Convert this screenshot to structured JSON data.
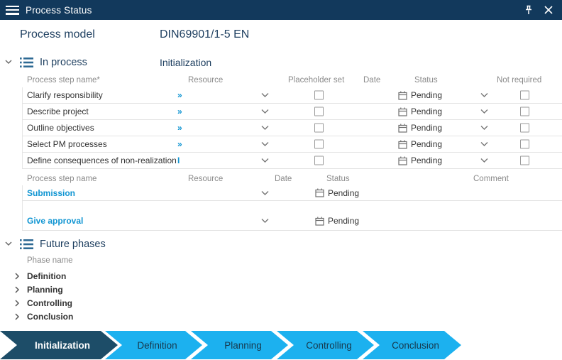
{
  "window": {
    "title": "Process Status"
  },
  "header": {
    "label": "Process model",
    "value": "DIN69901/1-5 EN"
  },
  "in_process": {
    "title": "In process",
    "phase": "Initialization",
    "columns": [
      "Process step name*",
      "Resource",
      "Placeholder set",
      "Date",
      "Status",
      "Not required"
    ],
    "rows": [
      {
        "name": "Clarify responsibility",
        "resource": "»",
        "status": "Pending"
      },
      {
        "name": "Describe project",
        "resource": "»",
        "status": "Pending"
      },
      {
        "name": "Outline objectives",
        "resource": "»",
        "status": "Pending"
      },
      {
        "name": "Select PM processes",
        "resource": "»",
        "status": "Pending"
      },
      {
        "name": "Define consequences of non-realization",
        "resource": "I",
        "status": "Pending"
      }
    ]
  },
  "approval": {
    "columns": [
      "Process step name",
      "Resource",
      "Date",
      "Status",
      "Comment"
    ],
    "rows": [
      {
        "name": "Submission",
        "status": "Pending"
      },
      {
        "name": "Give approval",
        "status": "Pending"
      }
    ]
  },
  "future_phases": {
    "title": "Future phases",
    "column": "Phase name",
    "items": [
      "Definition",
      "Planning",
      "Controlling",
      "Conclusion"
    ]
  },
  "ribbon": {
    "segments": [
      {
        "label": "Initialization",
        "active": true
      },
      {
        "label": "Definition",
        "active": false
      },
      {
        "label": "Planning",
        "active": false
      },
      {
        "label": "Controlling",
        "active": false
      },
      {
        "label": "Conclusion",
        "active": false
      }
    ]
  },
  "colors": {
    "titlebar_bg": "#12395c",
    "navy_text": "#1d3e5f",
    "link_blue": "#1095d2",
    "list_icon_blue": "#2e6a94",
    "header_gray": "#8a8a8a",
    "row_text": "#333333",
    "separator": "#e3e3e3",
    "arrow_dark": "#1d4d68",
    "arrow_light": "#1cb1ef",
    "arrow_text": "#17384c"
  }
}
